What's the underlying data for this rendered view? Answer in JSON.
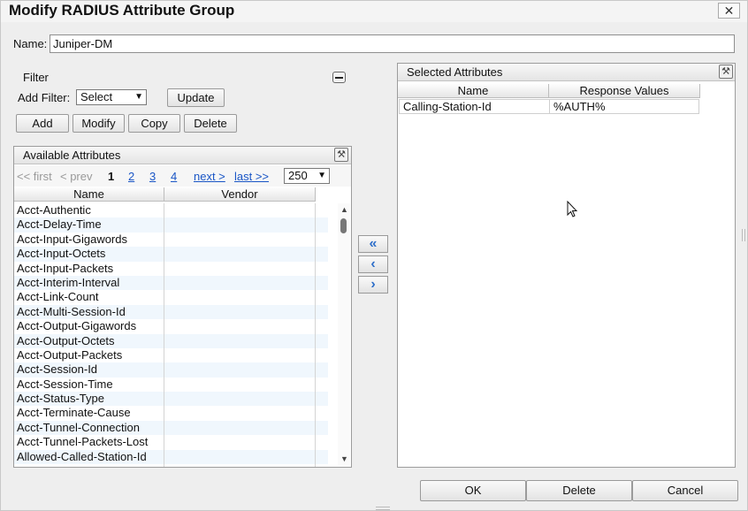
{
  "dialog": {
    "title": "Modify RADIUS Attribute Group",
    "close_label": "✕"
  },
  "name": {
    "label": "Name:",
    "value": "Juniper-DM"
  },
  "filter": {
    "title": "Filter",
    "add_filter_label": "Add Filter:",
    "select_value": "Select",
    "update_label": "Update"
  },
  "actions": {
    "add": "Add",
    "modify": "Modify",
    "copy": "Copy",
    "delete": "Delete"
  },
  "available": {
    "title": "Available Attributes",
    "pager": {
      "first": "<< first",
      "prev": "< prev",
      "pages": [
        "1",
        "2",
        "3",
        "4"
      ],
      "next": "next >",
      "last": "last >>",
      "page_size": "250"
    },
    "columns": [
      "Name",
      "Vendor"
    ],
    "rows": [
      "Acct-Authentic",
      "Acct-Delay-Time",
      "Acct-Input-Gigawords",
      "Acct-Input-Octets",
      "Acct-Input-Packets",
      "Acct-Interim-Interval",
      "Acct-Link-Count",
      "Acct-Multi-Session-Id",
      "Acct-Output-Gigawords",
      "Acct-Output-Octets",
      "Acct-Output-Packets",
      "Acct-Session-Id",
      "Acct-Session-Time",
      "Acct-Status-Type",
      "Acct-Terminate-Cause",
      "Acct-Tunnel-Connection",
      "Acct-Tunnel-Packets-Lost",
      "Allowed-Called-Station-Id"
    ]
  },
  "move_buttons": {
    "add_all": "«",
    "remove": "‹",
    "add": "›"
  },
  "selected": {
    "title": "Selected Attributes",
    "columns": [
      "Name",
      "Response Values"
    ],
    "rows": [
      {
        "name": "Calling-Station-Id",
        "value": "%AUTH%"
      }
    ]
  },
  "footer": {
    "ok": "OK",
    "delete": "Delete",
    "cancel": "Cancel"
  },
  "icons": {
    "close": "close-icon",
    "collapse": "minus-icon",
    "settings": "wrench-icon",
    "cursor": "mouse-pointer-icon"
  }
}
